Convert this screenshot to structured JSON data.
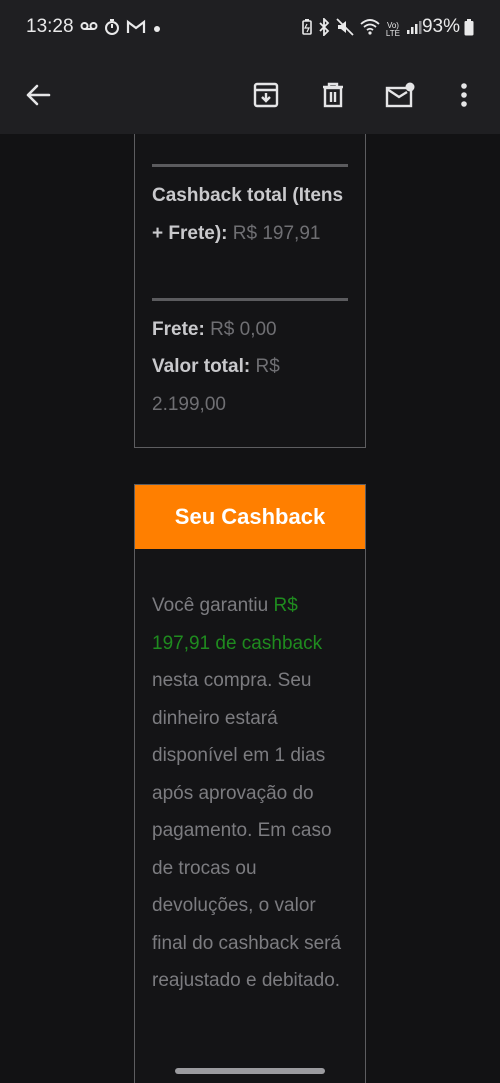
{
  "status_bar": {
    "time": "13:28",
    "battery_percent": "93%",
    "network": "LTE",
    "left_icons": [
      "voicemail-icon",
      "timer-icon",
      "gmail-icon",
      "dot-icon"
    ],
    "right_icons": [
      "battery-saver-icon",
      "bluetooth-icon",
      "mute-icon",
      "wifi-icon",
      "volte-icon",
      "signal-icon",
      "battery-icon"
    ]
  },
  "toolbar": {
    "back": "back-arrow-icon",
    "actions": [
      "archive-icon",
      "delete-icon",
      "mark-unread-icon",
      "more-icon"
    ]
  },
  "order_summary": {
    "cashback_total_label": "Cashback total (Itens + Frete):",
    "cashback_total_value": "R$ 197,91",
    "shipping_label": "Frete:",
    "shipping_value": "R$ 0,00",
    "total_label": "Valor total:",
    "total_value": "R$ 2.199,00"
  },
  "cashback": {
    "header": "Seu Cashback",
    "intro": "Você garantiu ",
    "highlight": "R$ 197,91 de cashback",
    "body": " nesta compra. Seu dinheiro estará disponível em 1 dias após aprovação do pagamento. Em caso de trocas ou devoluções, o valor final do cashback será reajustado e debitado.",
    "header_color": "#ff7f00",
    "highlight_color": "#1f8b1f"
  }
}
